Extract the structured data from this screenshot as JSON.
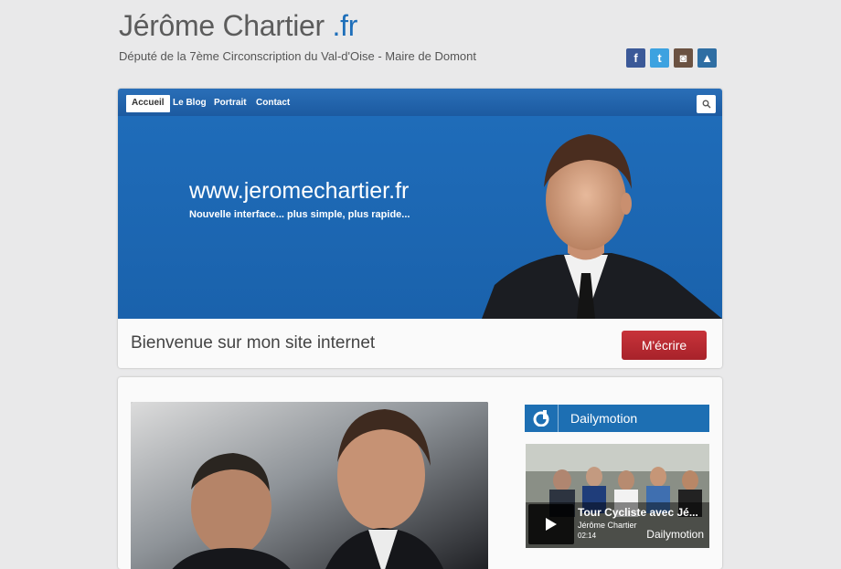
{
  "header": {
    "title_main": "Jérôme Chartier",
    "title_tld": " .fr",
    "subtitle": "Député de la 7ème Circonscription du Val-d'Oise - Maire de Domont",
    "social": [
      {
        "icon": "facebook-icon",
        "glyph": "f"
      },
      {
        "icon": "twitter-icon",
        "glyph": "t"
      },
      {
        "icon": "instagram-icon",
        "glyph": "◙"
      },
      {
        "icon": "other-social-icon",
        "glyph": "▲"
      }
    ]
  },
  "nav": {
    "items": [
      "Accueil",
      "Le Blog",
      "Portrait",
      "Contact"
    ],
    "active": "Accueil"
  },
  "banner": {
    "url": "www.jeromechartier.fr",
    "tagline": "Nouvelle interface... plus simple, plus rapide..."
  },
  "welcome": {
    "text": "Bienvenue sur mon site internet",
    "button": "M'écrire"
  },
  "sidebar": {
    "dailymotion_title": "Dailymotion",
    "video": {
      "title": "Tour Cycliste avec Jé...",
      "author": "Jérôme Chartier",
      "duration": "02:14",
      "brand": "Dailymotion"
    }
  },
  "colors": {
    "accent": "#1e6fba",
    "button_red": "#b8282f",
    "background": "#e9e9ea"
  }
}
